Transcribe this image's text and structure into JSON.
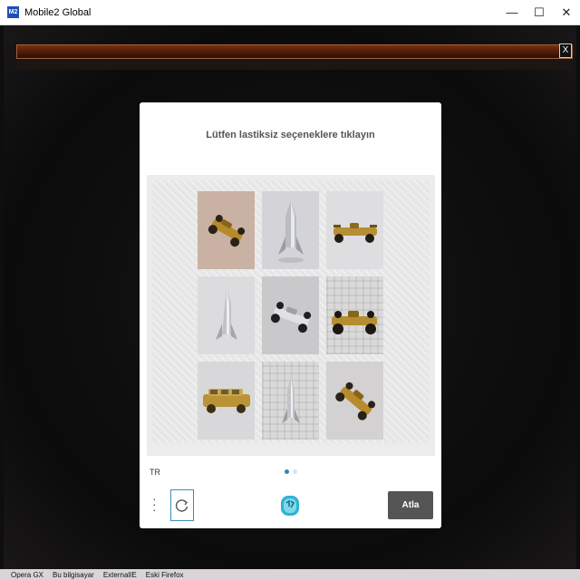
{
  "window": {
    "title": "Mobile2 Global",
    "app_icon_text": "M2",
    "controls": {
      "minimize": "—",
      "maximize": "☐",
      "close": "✕"
    }
  },
  "game": {
    "close_label": "X"
  },
  "captcha": {
    "prompt": "Lütfen lastiksiz seçeneklere tıklayın",
    "language": "TR",
    "skip_label": "Atla",
    "tiles": [
      {
        "subject": "gold-racing-car"
      },
      {
        "subject": "rocket"
      },
      {
        "subject": "gold-racing-car"
      },
      {
        "subject": "rocket"
      },
      {
        "subject": "silver-racing-car"
      },
      {
        "subject": "gold-racing-car"
      },
      {
        "subject": "gold-limousine"
      },
      {
        "subject": "rocket"
      },
      {
        "subject": "gold-racing-car"
      }
    ],
    "page_count": 2,
    "active_page": 1,
    "accent_color": "#2e88b8"
  },
  "taskbar": {
    "items": [
      "Opera GX",
      "Bu bilgisayar",
      "ExternalIE",
      "Eski Firefox"
    ]
  }
}
